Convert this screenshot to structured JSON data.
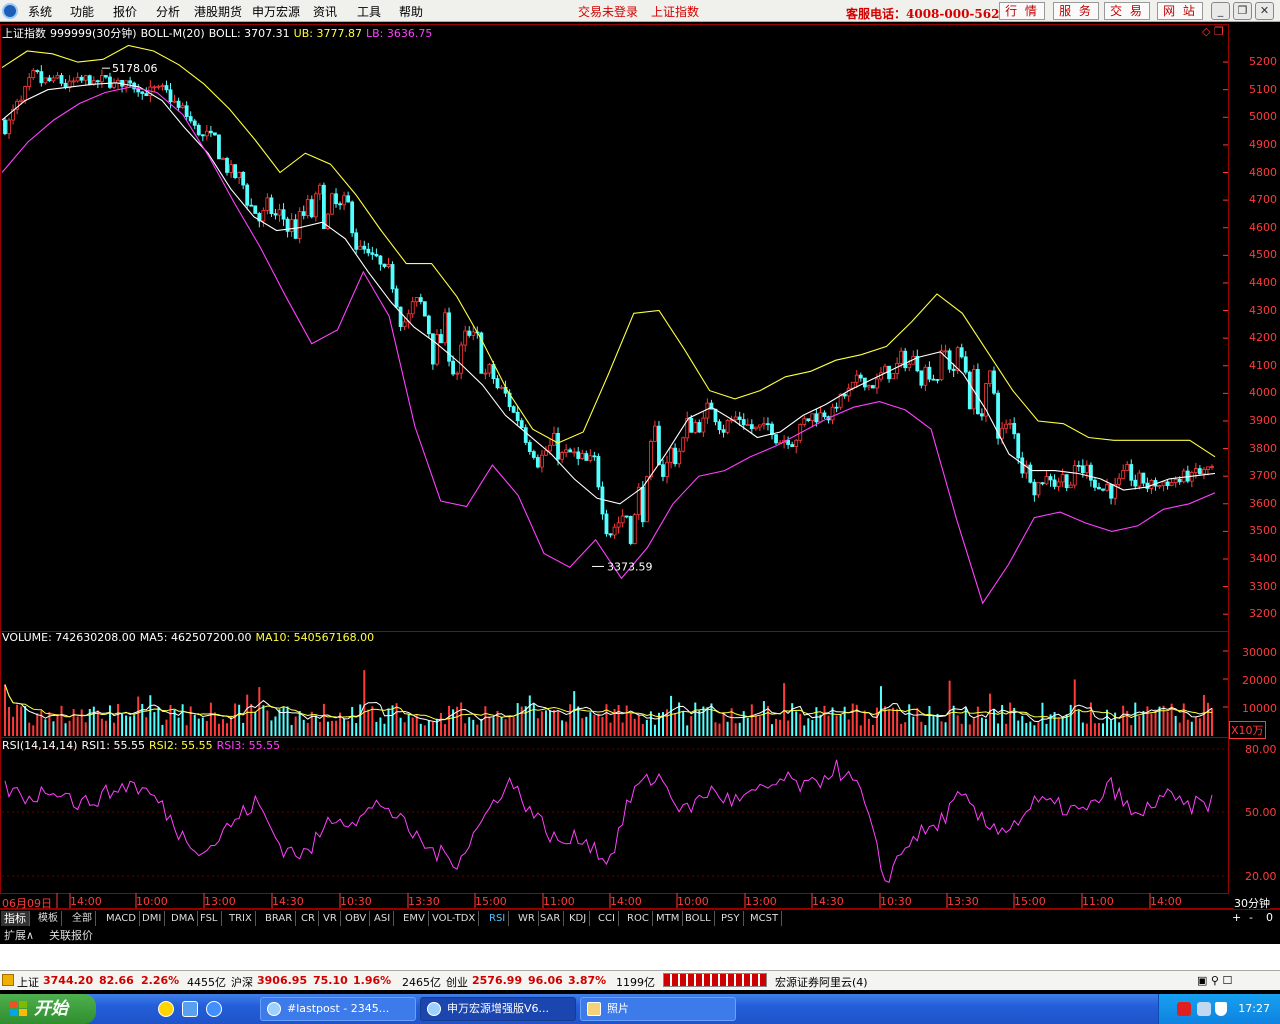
{
  "menubar": {
    "items": [
      "系统",
      "功能",
      "报价",
      "分析",
      "港股期货",
      "申万宏源",
      "资讯",
      "工具",
      "帮助"
    ],
    "trade_status": "交易未登录",
    "index_name": "上证指数",
    "hotline": "客服电话：4008-000-562",
    "buttons": [
      "行 情",
      "服 务",
      "交 易",
      "网 站"
    ]
  },
  "main_panel": {
    "title": "上证指数",
    "code": "999999(30分钟)",
    "indicator": "BOLL-M(20)",
    "boll_label": "BOLL: 3707.31",
    "ub_label": "UB: 3777.87",
    "lb_label": "LB: 3636.75",
    "high_marker": "5178.06",
    "low_marker": "3373.59",
    "y_ticks": [
      "5200",
      "5100",
      "5000",
      "4900",
      "4800",
      "4700",
      "4600",
      "4500",
      "4400",
      "4300",
      "4200",
      "4100",
      "4000",
      "3900",
      "3800",
      "3700",
      "3600",
      "3500",
      "3400",
      "3300",
      "3200"
    ]
  },
  "volume_panel": {
    "volume_label": "VOLUME: 742630208.00",
    "ma5_label": "MA5: 462507200.00",
    "ma10_label": "MA10: 540567168.00",
    "y_ticks": [
      "30000",
      "20000",
      "10000"
    ],
    "unit": "X10万"
  },
  "rsi_panel": {
    "params": "RSI(14,14,14)",
    "rsi1_label": "RSI1: 55.55",
    "rsi2_label": "RSI2: 55.55",
    "rsi3_label": "RSI3: 55.55",
    "y_ticks": [
      "80.00",
      "50.00",
      "20.00"
    ]
  },
  "x_axis": {
    "labels": [
      "06月09日",
      "14:00",
      "10:00",
      "13:00",
      "14:30",
      "10:30",
      "13:30",
      "15:00",
      "11:00",
      "14:00",
      "10:00",
      "13:00",
      "14:30",
      "10:30",
      "13:30",
      "15:00",
      "11:00",
      "14:00"
    ],
    "period": "30分钟"
  },
  "indicator_tabs": [
    "指标",
    "模板",
    "全部",
    "MACD",
    "DMI",
    "DMA",
    "FSL",
    "TRIX",
    "BRAR",
    "CR",
    "VR",
    "OBV",
    "ASI",
    "EMV",
    "VOL-TDX",
    "RSI",
    "WR",
    "SAR",
    "KDJ",
    "CCI",
    "ROC",
    "MTM",
    "BOLL",
    "PSY",
    "MCST"
  ],
  "active_tab": "RSI",
  "tab_controls": [
    "+",
    "-",
    "0"
  ],
  "sub_tabs": [
    "扩展∧",
    "关联报价"
  ],
  "status_bar": {
    "sh_name": "上证",
    "sh_value": "3744.20",
    "sh_change": "82.66",
    "sh_pct": "2.26%",
    "sh_amount": "4455亿",
    "hs_name": "沪深",
    "hs_value": "3906.95",
    "hs_change": "75.10",
    "hs_pct": "1.96%",
    "hs_amount": "2465亿",
    "cy_name": "创业",
    "cy_value": "2576.99",
    "cy_change": "96.06",
    "cy_pct": "3.87%",
    "cy_amount": "1199亿",
    "server": "宏源证券阿里云(4)"
  },
  "taskbar": {
    "start": "开始",
    "tasks": [
      "#lastpost - 2345...",
      "申万宏源增强版V6...",
      "照片"
    ],
    "clock": "17:27"
  },
  "colors": {
    "up": "#ff3a3a",
    "down": "#54ffff",
    "boll_mid": "#ffffff",
    "boll_ub": "#ffff40",
    "boll_lb": "#ff40ff",
    "ma_yellow": "#ffff40",
    "rsi": "#ff40ff",
    "grid": "#990000"
  },
  "chart_data": {
    "type": "candlestick",
    "title": "上证指数 999999(30分钟)",
    "indicator": "BOLL-M(20)",
    "ylim": [
      3150,
      5280
    ],
    "series": [
      {
        "name": "BOLL",
        "values": [
          4990,
          5060,
          5100,
          5110,
          5120,
          5125,
          5110,
          5060,
          4960,
          4870,
          4740,
          4640,
          4590,
          4600,
          4620,
          4560,
          4440,
          4330,
          4240,
          4180,
          4110,
          4030,
          3920,
          3850,
          3780,
          3690,
          3620,
          3600,
          3660,
          3780,
          3910,
          3950,
          3900,
          3840,
          3860,
          3920,
          3960,
          4010,
          4050,
          4090,
          4130,
          4150,
          4070,
          3940,
          3780,
          3720,
          3720,
          3710,
          3690,
          3650,
          3660,
          3690,
          3700,
          3710
        ]
      },
      {
        "name": "UB",
        "values": [
          5180,
          5240,
          5230,
          5200,
          5210,
          5260,
          5240,
          5190,
          5120,
          5030,
          4920,
          4800,
          4870,
          4830,
          4720,
          4590,
          4470,
          4470,
          4350,
          4190,
          4010,
          3870,
          3820,
          3860,
          4070,
          4290,
          4300,
          4160,
          4010,
          3980,
          4010,
          4060,
          4080,
          4120,
          4140,
          4170,
          4260,
          4360,
          4290,
          4150,
          4010,
          3900,
          3890,
          3840,
          3830,
          3830,
          3830,
          3830,
          3770
        ]
      },
      {
        "name": "LB",
        "values": [
          4800,
          4910,
          4990,
          5050,
          5090,
          5110,
          5090,
          5010,
          4860,
          4690,
          4530,
          4350,
          4180,
          4230,
          4440,
          4280,
          3880,
          3610,
          3590,
          3740,
          3630,
          3420,
          3370,
          3470,
          3330,
          3440,
          3600,
          3700,
          3720,
          3770,
          3810,
          3860,
          3910,
          3950,
          3970,
          3940,
          3870,
          3540,
          3240,
          3380,
          3550,
          3570,
          3530,
          3500,
          3520,
          3580,
          3600,
          3640
        ]
      }
    ],
    "markers": {
      "high": 5178.06,
      "low": 3373.59
    },
    "volume": {
      "ylim": [
        0,
        35000
      ],
      "unit": "X10万"
    },
    "rsi": {
      "ylim": [
        10,
        85
      ],
      "values": [
        65,
        60,
        66,
        56,
        62,
        68,
        60,
        40,
        31,
        46,
        58,
        33,
        29,
        50,
        48,
        58,
        43,
        31,
        26,
        48,
        70,
        52,
        35,
        39,
        25,
        65,
        72,
        52,
        64,
        58,
        63,
        70,
        65,
        77,
        65,
        15,
        38,
        44,
        61,
        45,
        44,
        58,
        55,
        52,
        67,
        48,
        62,
        55,
        58
      ]
    }
  }
}
